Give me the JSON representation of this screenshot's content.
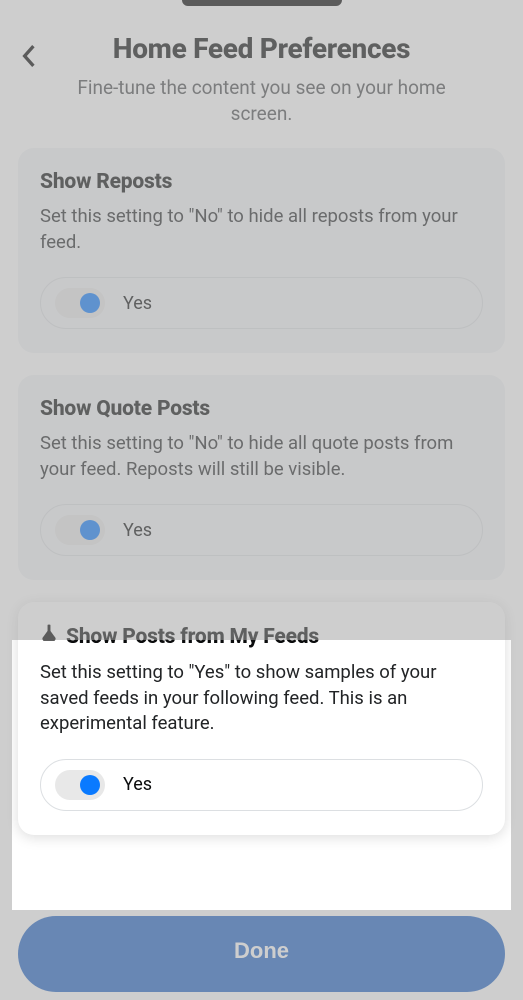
{
  "header": {
    "title": "Home Feed Preferences",
    "subtitle": "Fine-tune the content you see on your home screen."
  },
  "cards": [
    {
      "title": "Show Reposts",
      "description": "Set this setting to \"No\" to hide all reposts from your feed.",
      "toggle_label": "Yes",
      "toggle_on": true,
      "experimental": false
    },
    {
      "title": "Show Quote Posts",
      "description": "Set this setting to \"No\" to hide all quote posts from your feed. Reposts will still be visible.",
      "toggle_label": "Yes",
      "toggle_on": true,
      "experimental": false
    },
    {
      "title": "Show Posts from My Feeds",
      "description": "Set this setting to \"Yes\" to show samples of your saved feeds in your following feed. This is an experimental feature.",
      "toggle_label": "Yes",
      "toggle_on": true,
      "experimental": true
    }
  ],
  "footer": {
    "done_label": "Done"
  },
  "colors": {
    "accent_blue": "#0a7aff",
    "primary_button": "#1e63c5"
  },
  "highlight_card_index": 2
}
